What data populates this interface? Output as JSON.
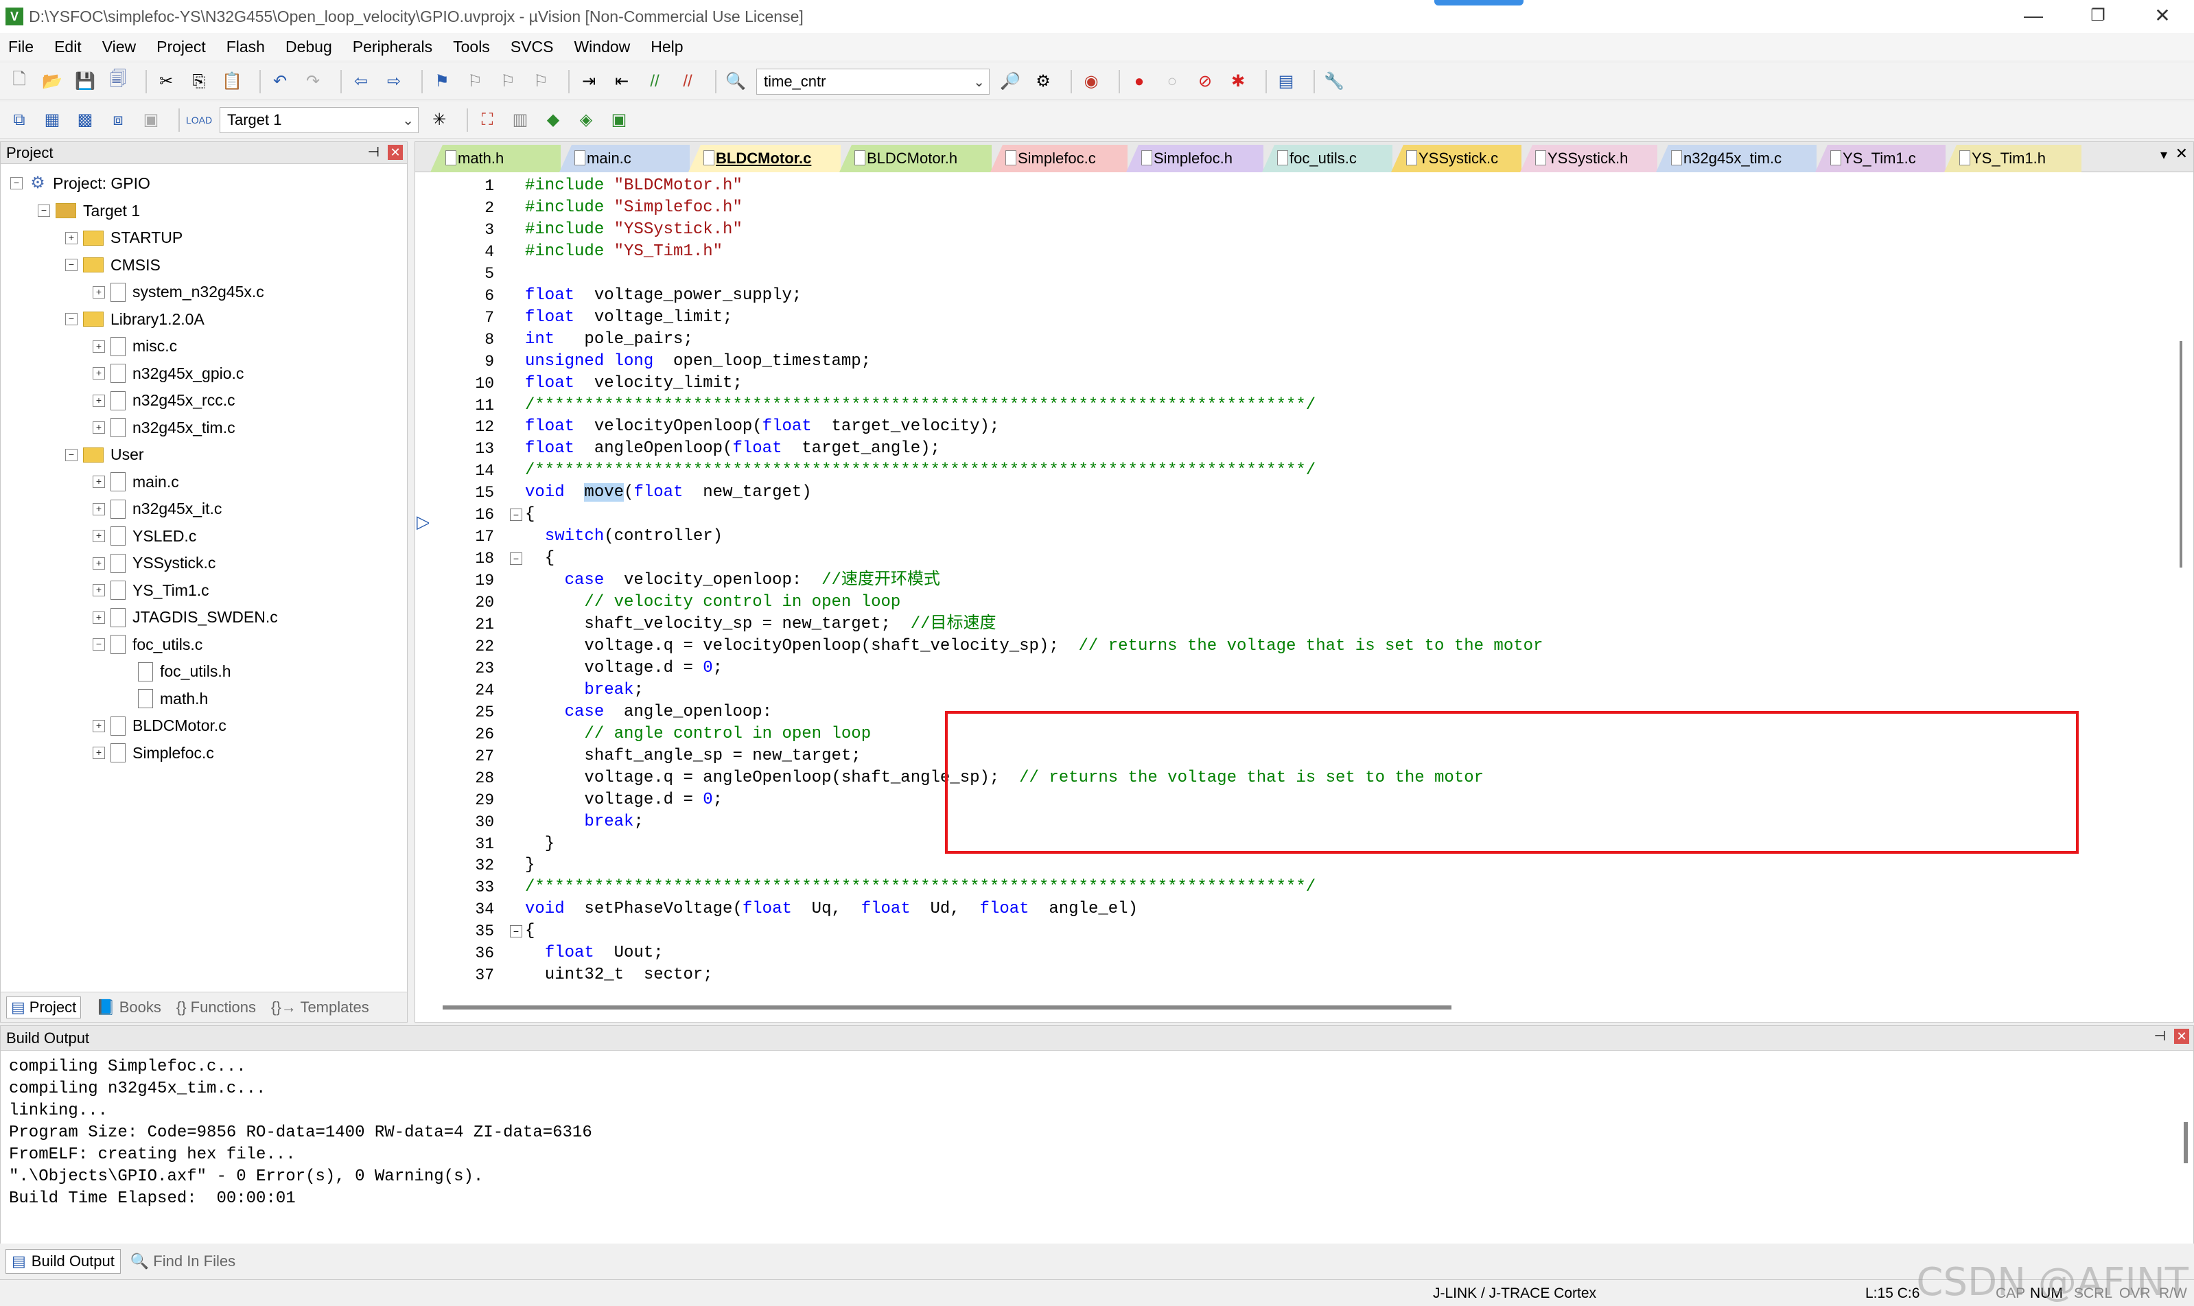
{
  "window": {
    "title": "D:\\YSFOC\\simplefoc-YS\\N32G455\\Open_loop_velocity\\GPIO.uvprojx - µVision  [Non-Commercial Use License]",
    "min": "—",
    "max": "❐",
    "close": "✕"
  },
  "menu": [
    "File",
    "Edit",
    "View",
    "Project",
    "Flash",
    "Debug",
    "Peripherals",
    "Tools",
    "SVCS",
    "Window",
    "Help"
  ],
  "toolbar": {
    "find_combo": "time_cntr",
    "target_combo": "Target 1"
  },
  "project_panel": {
    "header": "Project",
    "root": "Project: GPIO",
    "tree": [
      {
        "label": "Target 1",
        "type": "target",
        "expander": "−"
      },
      {
        "label": "STARTUP",
        "type": "folder",
        "expander": "+"
      },
      {
        "label": "CMSIS",
        "type": "folder",
        "expander": "−"
      },
      {
        "label": "system_n32g45x.c",
        "type": "file",
        "expander": "+"
      },
      {
        "label": "Library1.2.0A",
        "type": "folder",
        "expander": "−"
      },
      {
        "label": "misc.c",
        "type": "file",
        "expander": "+"
      },
      {
        "label": "n32g45x_gpio.c",
        "type": "file",
        "expander": "+"
      },
      {
        "label": "n32g45x_rcc.c",
        "type": "file",
        "expander": "+"
      },
      {
        "label": "n32g45x_tim.c",
        "type": "file",
        "expander": "+"
      },
      {
        "label": "User",
        "type": "folder",
        "expander": "−"
      },
      {
        "label": "main.c",
        "type": "file",
        "expander": "+"
      },
      {
        "label": "n32g45x_it.c",
        "type": "file",
        "expander": "+"
      },
      {
        "label": "YSLED.c",
        "type": "file",
        "expander": "+"
      },
      {
        "label": "YSSystick.c",
        "type": "file",
        "expander": "+"
      },
      {
        "label": "YS_Tim1.c",
        "type": "file",
        "expander": "+"
      },
      {
        "label": "JTAGDIS_SWDEN.c",
        "type": "file",
        "expander": "+"
      },
      {
        "label": "foc_utils.c",
        "type": "file",
        "expander": "−"
      },
      {
        "label": "foc_utils.h",
        "type": "file",
        "expander": ""
      },
      {
        "label": "math.h",
        "type": "file",
        "expander": ""
      },
      {
        "label": "BLDCMotor.c",
        "type": "file",
        "expander": "+"
      },
      {
        "label": "Simplefoc.c",
        "type": "file",
        "expander": "+"
      }
    ],
    "tabs": [
      "Project",
      "Books",
      "{} Functions",
      "{}→ Templates"
    ]
  },
  "file_tabs": [
    {
      "label": "math.h",
      "color": "#c8e6a0"
    },
    {
      "label": "main.c",
      "color": "#c8d8f0"
    },
    {
      "label": "BLDCMotor.c",
      "color": "#f5d76e"
    },
    {
      "label": "BLDCMotor.h",
      "color": "#c8e6a0"
    },
    {
      "label": "Simplefoc.c",
      "color": "#f7c6c6"
    },
    {
      "label": "Simplefoc.h",
      "color": "#d8c8f0"
    },
    {
      "label": "foc_utils.c",
      "color": "#c8e6e0"
    },
    {
      "label": "YSSystick.c",
      "color": "#f5d76e"
    },
    {
      "label": "YSSystick.h",
      "color": "#f0d0e0"
    },
    {
      "label": "n32g45x_tim.c",
      "color": "#c8d8f0"
    },
    {
      "label": "YS_Tim1.c",
      "color": "#e0c8e8"
    },
    {
      "label": "YS_Tim1.h",
      "color": "#f0e8b0"
    }
  ],
  "code_lines": [
    [
      [
        "pp",
        "#include "
      ],
      [
        "str",
        "\"BLDCMotor.h\""
      ]
    ],
    [
      [
        "pp",
        "#include "
      ],
      [
        "str",
        "\"Simplefoc.h\""
      ]
    ],
    [
      [
        "pp",
        "#include "
      ],
      [
        "str",
        "\"YSSystick.h\""
      ]
    ],
    [
      [
        "pp",
        "#include "
      ],
      [
        "str",
        "\"YS_Tim1.h\""
      ]
    ],
    [],
    [
      [
        "kw",
        "float"
      ],
      [
        "",
        "  voltage_power_supply;"
      ]
    ],
    [
      [
        "kw",
        "float"
      ],
      [
        "",
        "  voltage_limit;"
      ]
    ],
    [
      [
        "kw",
        "int"
      ],
      [
        "",
        "   pole_pairs;"
      ]
    ],
    [
      [
        "kw",
        "unsigned long"
      ],
      [
        "",
        "  open_loop_timestamp;"
      ]
    ],
    [
      [
        "kw",
        "float"
      ],
      [
        "",
        "  velocity_limit;"
      ]
    ],
    [
      [
        "cm",
        "/******************************************************************************/"
      ]
    ],
    [
      [
        "kw",
        "float"
      ],
      [
        "",
        "  velocityOpenloop("
      ],
      [
        "kw",
        "float"
      ],
      [
        "",
        "  target_velocity);"
      ]
    ],
    [
      [
        "kw",
        "float"
      ],
      [
        "",
        "  angleOpenloop("
      ],
      [
        "kw",
        "float"
      ],
      [
        "",
        "  target_angle);"
      ]
    ],
    [
      [
        "cm",
        "/******************************************************************************/"
      ]
    ],
    [
      [
        "kw",
        "void"
      ],
      [
        "",
        "  "
      ],
      [
        "hl",
        "move"
      ],
      [
        "",
        "("
      ],
      [
        "kw",
        "float"
      ],
      [
        "",
        "  new_target)"
      ]
    ],
    [
      [
        "",
        "{"
      ]
    ],
    [
      [
        "",
        "  "
      ],
      [
        "kw",
        "switch"
      ],
      [
        "",
        "(controller)"
      ]
    ],
    [
      [
        "",
        "  {"
      ]
    ],
    [
      [
        "",
        "    "
      ],
      [
        "kw",
        "case"
      ],
      [
        "",
        "  velocity_openloop:  "
      ],
      [
        "cm",
        "//速度开环模式"
      ]
    ],
    [
      [
        "",
        "      "
      ],
      [
        "cm",
        "// velocity control in open loop"
      ]
    ],
    [
      [
        "",
        "      shaft_velocity_sp = new_target;  "
      ],
      [
        "cm",
        "//目标速度"
      ]
    ],
    [
      [
        "",
        "      voltage.q = velocityOpenloop(shaft_velocity_sp);  "
      ],
      [
        "cm",
        "// returns the voltage that is set to the motor"
      ]
    ],
    [
      [
        "",
        "      voltage.d = "
      ],
      [
        "num",
        "0"
      ],
      [
        "",
        ";"
      ]
    ],
    [
      [
        "",
        "      "
      ],
      [
        "kw",
        "break"
      ],
      [
        "",
        ";"
      ]
    ],
    [
      [
        "",
        "    "
      ],
      [
        "kw",
        "case"
      ],
      [
        "",
        "  angle_openloop:"
      ]
    ],
    [
      [
        "",
        "      "
      ],
      [
        "cm",
        "// angle control in open loop"
      ]
    ],
    [
      [
        "",
        "      shaft_angle_sp = new_target;"
      ]
    ],
    [
      [
        "",
        "      voltage.q = angleOpenloop(shaft_angle_sp);  "
      ],
      [
        "cm",
        "// returns the voltage that is set to the motor"
      ]
    ],
    [
      [
        "",
        "      voltage.d = "
      ],
      [
        "num",
        "0"
      ],
      [
        "",
        ";"
      ]
    ],
    [
      [
        "",
        "      "
      ],
      [
        "kw",
        "break"
      ],
      [
        "",
        ";"
      ]
    ],
    [
      [
        "",
        "  }"
      ]
    ],
    [
      [
        "",
        "}"
      ]
    ],
    [
      [
        "cm",
        "/******************************************************************************/"
      ]
    ],
    [
      [
        "kw",
        "void"
      ],
      [
        "",
        "  setPhaseVoltage("
      ],
      [
        "kw",
        "float"
      ],
      [
        "",
        "  Uq,  "
      ],
      [
        "kw",
        "float"
      ],
      [
        "",
        "  Ud,  "
      ],
      [
        "kw",
        "float"
      ],
      [
        "",
        "  angle_el)"
      ]
    ],
    [
      [
        "",
        "{"
      ]
    ],
    [
      [
        "",
        "  "
      ],
      [
        "kw",
        "float"
      ],
      [
        "",
        "  Uout;"
      ]
    ],
    [
      [
        "",
        "  uint32_t  sector;"
      ]
    ]
  ],
  "build_output": {
    "header": "Build Output",
    "lines": [
      "compiling Simplefoc.c...",
      "compiling n32g45x_tim.c...",
      "linking...",
      "Program Size: Code=9856 RO-data=1400 RW-data=4 ZI-data=6316",
      "FromELF: creating hex file...",
      "\".\\Objects\\GPIO.axf\" - 0 Error(s), 0 Warning(s).",
      "Build Time Elapsed:  00:00:01"
    ],
    "tabs": [
      "Build Output",
      "Find In Files"
    ]
  },
  "status": {
    "debugger": "J-LINK / J-TRACE Cortex",
    "position": "L:15 C:6",
    "indicators": [
      "CAP",
      "NUM",
      "SCRL",
      "OVR",
      "R/W"
    ]
  },
  "watermark": "CSDN @AFINT",
  "colors": {
    "highlight_box": "#e8161b",
    "keyword": "#0000ff",
    "comment": "#008000",
    "string": "#a31515"
  }
}
